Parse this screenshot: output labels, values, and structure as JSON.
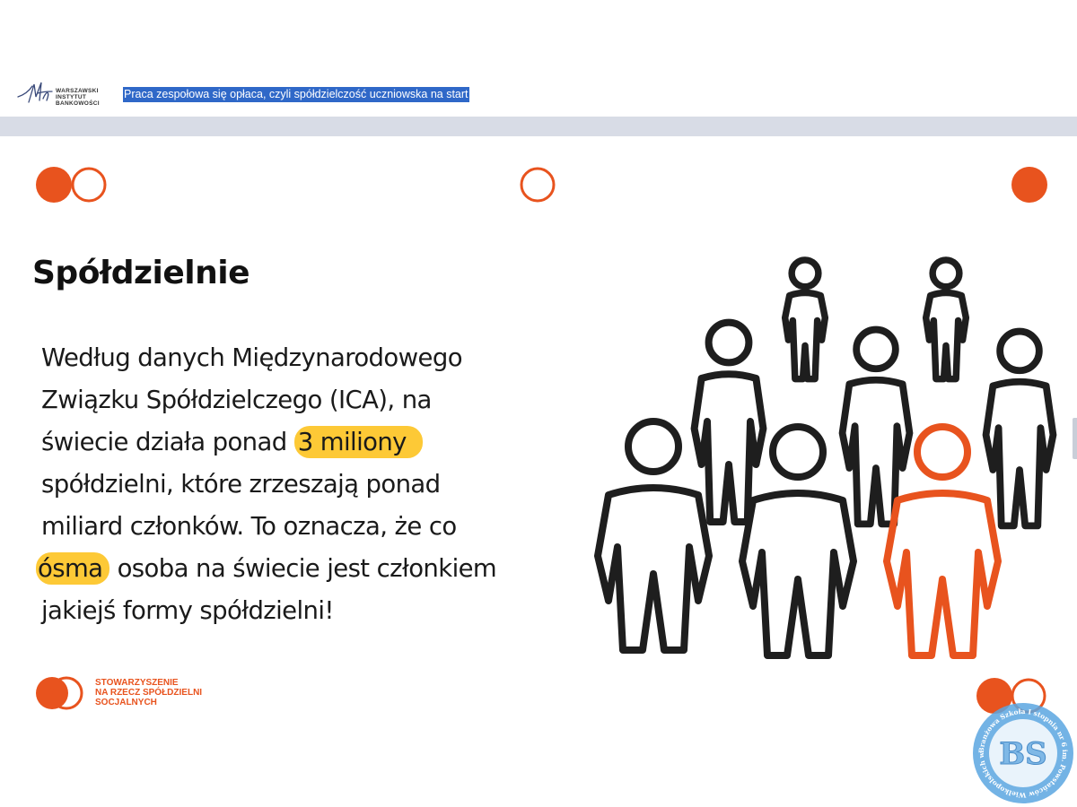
{
  "header": {
    "logo_lines": [
      "WARSZAWSKI",
      "INSTYTUT",
      "BANKOWOŚCI"
    ],
    "document_title": "Praca zespołowa się opłaca, czyli spółdzielczość uczniowska na start"
  },
  "slide": {
    "title": "Spółdzielnie",
    "body_lines": [
      "Według danych Międzynarodowego",
      "Związku Spółdzielczego (ICA), na",
      "świecie działa ponad",
      "3 miliony",
      "spółdzielni, które zrzeszają ponad",
      "miliard członków. To oznacza, że co",
      "ósma",
      "osoba na świecie jest członkiem",
      "jakiejś formy spółdzielni!"
    ],
    "highlight_color": "#fdc936",
    "accent_color": "#e8531e",
    "people_icon_count": 8,
    "highlighted_person_count": 1
  },
  "footer": {
    "org_lines": [
      "STOWARZYSZENIE",
      "NA RZECZ SPÓŁDZIELNI",
      "SOCJALNYCH"
    ],
    "badge_ring_text": "Branżowa Szkoła I stopnia nr 6 im. Powstańców Wielkopolskich w Bydgoszczy",
    "badge_initials": "BS"
  }
}
